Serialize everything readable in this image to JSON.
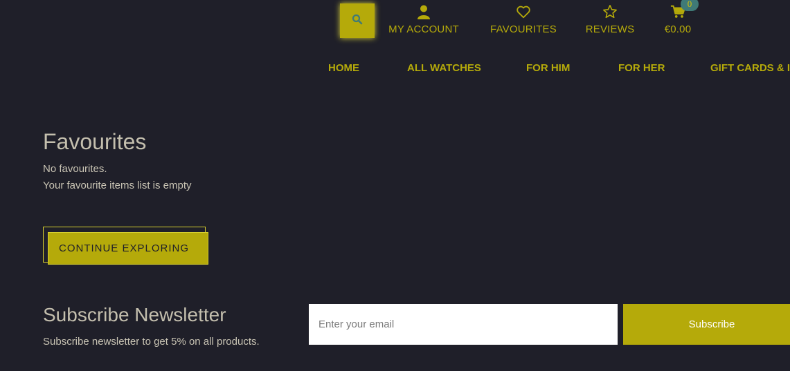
{
  "header": {
    "search_icon": "search-icon",
    "items": [
      {
        "label": "MY ACCOUNT",
        "icon": "user-icon"
      },
      {
        "label": "FAVOURITES",
        "icon": "heart-icon"
      },
      {
        "label": "REVIEWS",
        "icon": "star-icon"
      },
      {
        "label": "€0.00",
        "icon": "cart-icon"
      }
    ],
    "cart_count": "0"
  },
  "nav": [
    "HOME",
    "ALL WATCHES",
    "FOR HIM",
    "FOR HER",
    "GIFT CARDS & I"
  ],
  "main": {
    "title": "Favourites",
    "empty_line1": "No favourites.",
    "empty_line2": "Your favourite items list is empty",
    "cta_label": "CONTINUE EXPLORING"
  },
  "newsletter": {
    "title": "Subscribe Newsletter",
    "subtitle": "Subscribe newsletter to get 5% on all products.",
    "email_placeholder": "Enter your email",
    "button_label": "Subscribe"
  },
  "colors": {
    "background": "#1f1f29",
    "accent": "#b5aa0a",
    "badge": "#3f7a77"
  }
}
